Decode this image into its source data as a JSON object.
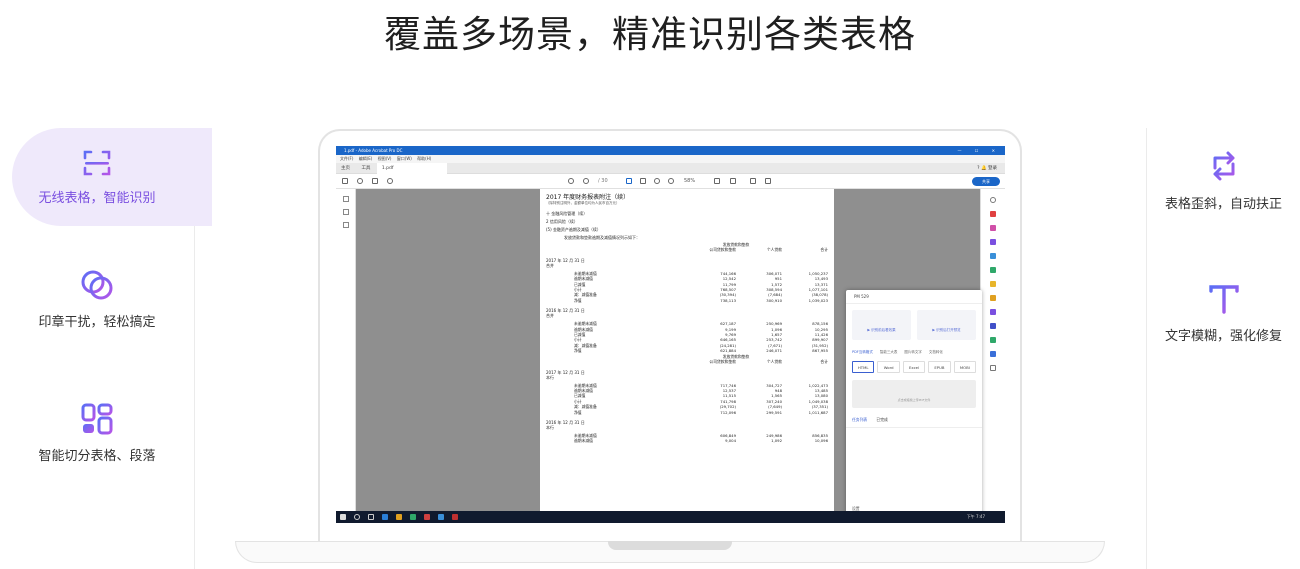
{
  "page": {
    "title": "覆盖多场景，精准识别各类表格"
  },
  "left_features": [
    {
      "label": "无线表格，智能识别",
      "icon": "scan-frame-icon",
      "active": true
    },
    {
      "label": "印章干扰，轻松搞定",
      "icon": "overlapping-circles-icon",
      "active": false
    },
    {
      "label": "智能切分表格、段落",
      "icon": "layout-blocks-icon",
      "active": false
    }
  ],
  "right_features": [
    {
      "label": "表格歪斜，自动扶正",
      "icon": "rotate-arrows-icon"
    },
    {
      "label": "文字模糊，强化修复",
      "icon": "text-t-icon"
    }
  ],
  "colors": {
    "accent": "#7a4fe0",
    "active_bg": "#efe9fb",
    "gradient_a": "#5b6ef5",
    "gradient_b": "#b455e8"
  },
  "screen": {
    "window_title": "1.pdf - Adobe Acrobat Pro DC",
    "window_controls": "— ☐ ✕",
    "menu": [
      "文件(F)",
      "编辑(E)",
      "视图(V)",
      "窗口(W)",
      "帮助(H)"
    ],
    "tabs": [
      "主页",
      "工具",
      "1.pdf"
    ],
    "tab_right": "? 🔔 登录",
    "toolbar_pages": "/ 30",
    "zoom": "58%",
    "share_label": "共享",
    "doc": {
      "title": "2017 年度财务报表附注（续）",
      "subtitle": "（除特别注明外，金额单位均为人民币百万元）",
      "lines": [
        "十    金融风险管理（续）",
        "2    信用风险（续）",
        "(5)    金融资产逾期及减值（续）",
        "发放贷款和垫款逾期及减值情况列示如下："
      ],
      "col_group": "发放贷款和垫款",
      "cols": [
        "公司贷款和垫款",
        "个人贷款",
        "合计"
      ],
      "blocks": [
        {
          "date": "2017 年 12 月 31 日",
          "scope": "合并",
          "rows": [
            [
              "未逾期未减值",
              "744,166",
              "306,071",
              "1,050,237"
            ],
            [
              "逾期未减值",
              "12,542",
              "951",
              "13,493"
            ],
            [
              "已减值",
              "11,799",
              "1,572",
              "13,371"
            ],
            [
              "小计",
              "768,507",
              "308,594",
              "1,077,101"
            ],
            [
              "减：减值准备",
              "(30,394)",
              "(7,684)",
              "(38,078)"
            ],
            [
              "净值",
              "738,113",
              "300,910",
              "1,039,023"
            ]
          ]
        },
        {
          "date": "2016 年 12 月 31 日",
          "scope": "合并",
          "rows": [
            [
              "未逾期未减值",
              "627,187",
              "250,969",
              "878,156"
            ],
            [
              "逾期未减值",
              "9,199",
              "1,096",
              "10,295"
            ],
            [
              "已减值",
              "9,769",
              "1,657",
              "11,426"
            ],
            [
              "小计",
              "646,165",
              "253,742",
              "899,907"
            ],
            [
              "减：减值准备",
              "(24,281)",
              "(7,671)",
              "(31,952)"
            ],
            [
              "净值",
              "621,884",
              "246,071",
              "867,955"
            ]
          ]
        },
        {
          "date": "2017 年 12 月 31 日",
          "scope": "本行",
          "rows": [
            [
              "未逾期未减值",
              "717,746",
              "304,727",
              "1,022,473"
            ],
            [
              "逾期未减值",
              "12,537",
              "948",
              "13,485"
            ],
            [
              "已减值",
              "11,515",
              "1,565",
              "13,080"
            ],
            [
              "小计",
              "741,798",
              "307,240",
              "1,049,038"
            ],
            [
              "减：减值准备",
              "(29,702)",
              "(7,649)",
              "(37,351)"
            ],
            [
              "净值",
              "712,096",
              "299,591",
              "1,011,687"
            ]
          ]
        },
        {
          "date": "2016 年 12 月 31 日",
          "scope": "本行",
          "rows": [
            [
              "未逾期未减值",
              "606,849",
              "249,986",
              "856,835"
            ],
            [
              "逾期未减值",
              "9,004",
              "1,092",
              "10,096"
            ]
          ]
        }
      ]
    },
    "panel": {
      "header": "PM  529",
      "cards": [
        "▶ 识别前后看效果",
        "▶ 识别后打开预览"
      ],
      "tabs": [
        "PDF互转格式",
        "智能三大表",
        "图片转文字",
        "文档转化"
      ],
      "formats": [
        "HTML",
        "Word",
        "Excel",
        "EPUB",
        "MOBI"
      ],
      "drop_hint": "点击或拖拽上传PDF文件",
      "task_tabs": [
        "任务列表",
        "已完成"
      ],
      "footer": "设置"
    },
    "clock": "下午 7:47"
  }
}
